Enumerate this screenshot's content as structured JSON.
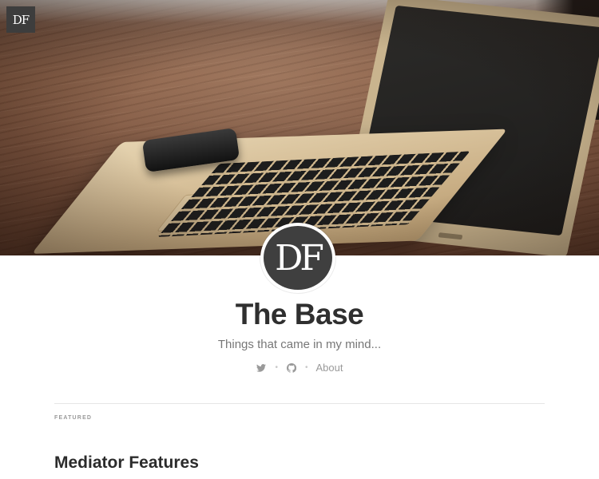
{
  "header": {
    "corner_logo": "DF",
    "avatar_initials": "DF",
    "title": "The Base",
    "tagline": "Things that came in my mind...",
    "social": [
      {
        "icon": "twitter-icon"
      },
      {
        "icon": "github-icon"
      },
      {
        "label": "About"
      }
    ]
  },
  "main": {
    "section_label": "FEATURED",
    "post_title": "Mediator Features"
  },
  "colors": {
    "text_dark": "#2f2f2f",
    "text_muted": "#777777",
    "logo_bg": "#3d3d3d"
  }
}
